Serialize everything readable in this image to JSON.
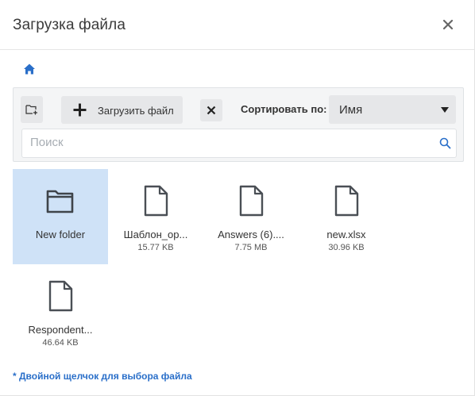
{
  "dialog": {
    "title": "Загрузка файла"
  },
  "toolbar": {
    "upload_label": "Загрузить файл",
    "sort_label": "Сортировать по:",
    "sort_value": "Имя"
  },
  "search": {
    "placeholder": "Поиск"
  },
  "items": [
    {
      "type": "folder",
      "name": "New folder",
      "size": ""
    },
    {
      "type": "file",
      "name": "Шаблон_ор...",
      "size": "15.77 KB"
    },
    {
      "type": "file",
      "name": "Answers (6)....",
      "size": "7.75 MB"
    },
    {
      "type": "file",
      "name": "new.xlsx",
      "size": "30.96 KB"
    },
    {
      "type": "file",
      "name": "Respondent...",
      "size": "46.64 KB"
    }
  ],
  "footer": {
    "hint": "* Двойной щелчок для выбора файла"
  },
  "colors": {
    "accent": "#2a6fc9",
    "selected_bg": "#cfe2f7",
    "icon": "#4a4f55"
  }
}
